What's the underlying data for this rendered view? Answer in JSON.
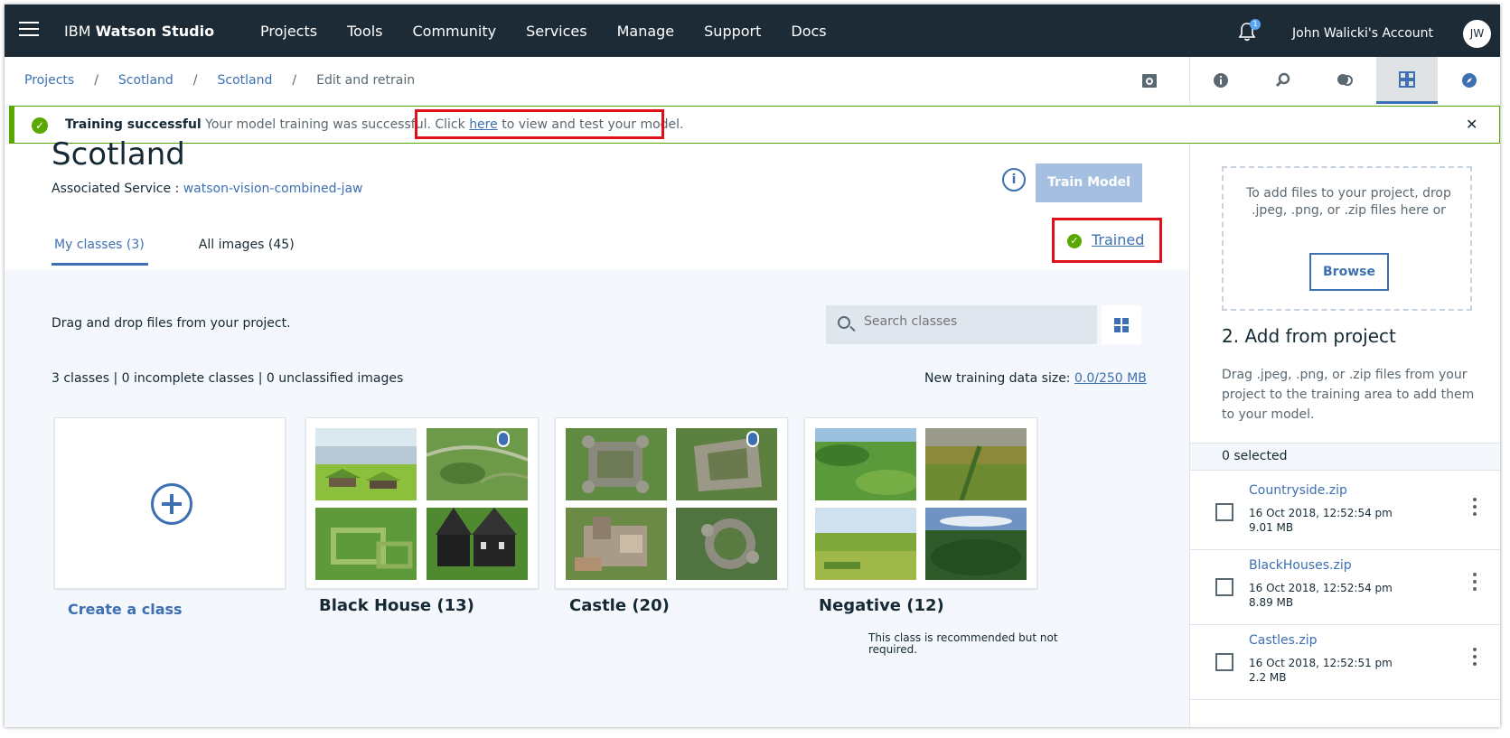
{
  "nav": {
    "brand_prefix": "IBM",
    "brand_name": "Watson Studio",
    "links": [
      "Projects",
      "Tools",
      "Community",
      "Services",
      "Manage",
      "Support",
      "Docs"
    ],
    "notification_count": "1",
    "account": "John Walicki's Account",
    "avatar_initials": "JW"
  },
  "breadcrumb": {
    "items": [
      "Projects",
      "Scotland",
      "Scotland"
    ],
    "separator": "/",
    "current": "Edit and retrain"
  },
  "notification": {
    "title": "Training successful",
    "message": "Your model training was successful.",
    "link_prefix": "Click",
    "link_text": "here",
    "link_suffix": "to view and test your model.",
    "close": "✕",
    "status_color": "#5aa700"
  },
  "model": {
    "name": "Scotland",
    "service_label": "Associated Service :",
    "service_name": "watson-vision-combined-jaw",
    "info_label": "i",
    "train_button": "Train Model",
    "status": "Trained"
  },
  "tabs": [
    {
      "label": "My classes (3)",
      "active": true
    },
    {
      "label": "All images (45)",
      "active": false
    }
  ],
  "content": {
    "drag_hint": "Drag and drop files from your project.",
    "search_placeholder": "Search classes",
    "stats": "3 classes | 0 incomplete classes | 0 unclassified images",
    "data_size_label": "New training data size:",
    "data_size_value": "0.0/250 MB",
    "create_label": "Create a class",
    "classes": [
      {
        "name": "Black House (13)",
        "locked": true
      },
      {
        "name": "Castle (20)",
        "locked": true
      },
      {
        "name": "Negative (12)",
        "locked": false,
        "note": "This class is recommended but not required."
      }
    ]
  },
  "right_panel": {
    "dropzone_text": "To add files to your project, drop .jpeg, .png, or .zip files here or",
    "browse_button": "Browse",
    "add_title": "2. Add from project",
    "add_description": "Drag .jpeg, .png, or .zip files from your project to the training area to add them to your model.",
    "selected": "0 selected",
    "files": [
      {
        "name": "Countryside.zip",
        "date": "16 Oct 2018, 12:52:54 pm",
        "size": "9.01 MB"
      },
      {
        "name": "BlackHouses.zip",
        "date": "16 Oct 2018, 12:52:54 pm",
        "size": "8.89 MB"
      },
      {
        "name": "Castles.zip",
        "date": "16 Oct 2018, 12:52:51 pm",
        "size": "2.2 MB"
      }
    ]
  },
  "colors": {
    "nav_bg": "#1d2b36",
    "accent": "#3d70b2",
    "success": "#5aa700",
    "highlight": "#e0101b"
  }
}
